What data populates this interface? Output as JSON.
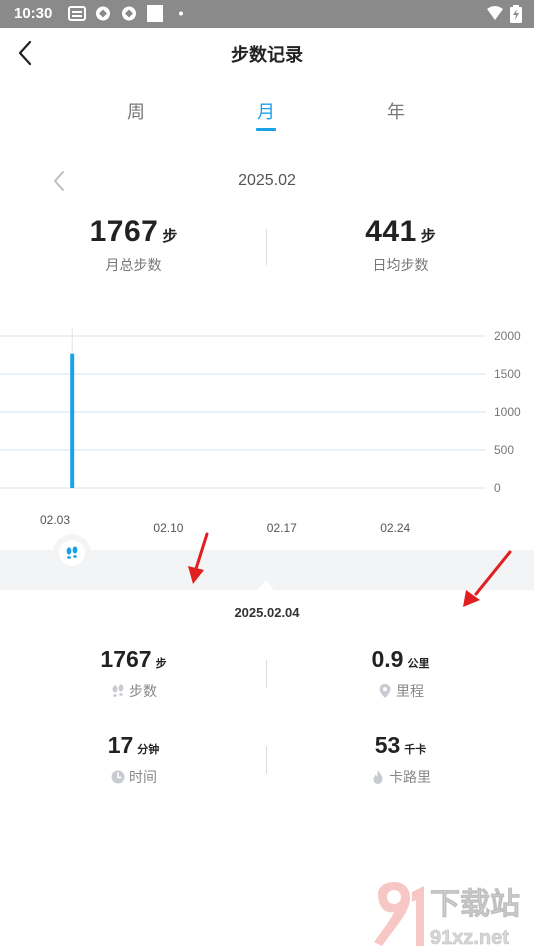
{
  "status": {
    "time": "10:30"
  },
  "header": {
    "title": "步数记录"
  },
  "tabs": [
    {
      "label": "周",
      "active": false
    },
    {
      "label": "月",
      "active": true
    },
    {
      "label": "年",
      "active": false
    }
  ],
  "date_nav": {
    "current": "2025.02"
  },
  "summary": {
    "total": {
      "value": "1767",
      "unit": "步",
      "label": "月总步数"
    },
    "average": {
      "value": "441",
      "unit": "步",
      "label": "日均步数"
    }
  },
  "chart_data": {
    "type": "bar",
    "x_tick_labels": [
      "02.03",
      "02.10",
      "02.17",
      "02.24"
    ],
    "y_tick_labels": [
      "2000",
      "1500",
      "1000",
      "500",
      "0"
    ],
    "ylim": [
      0,
      2000
    ],
    "bars": [
      {
        "x": "02.04",
        "value": 1767
      }
    ],
    "grid": true,
    "bar_color": "#1aa1ea"
  },
  "detail": {
    "date": "2025.02.04",
    "steps": {
      "value": "1767",
      "unit": "步",
      "label": "步数",
      "icon": "footprints-icon"
    },
    "distance": {
      "value": "0.9",
      "unit": "公里",
      "label": "里程",
      "icon": "location-pin-icon"
    },
    "time": {
      "value": "17",
      "unit": "分钟",
      "label": "时间",
      "icon": "clock-icon"
    },
    "calories": {
      "value": "53",
      "unit": "千卡",
      "label": "卡路里",
      "icon": "flame-icon"
    }
  },
  "watermark": {
    "text": "下载站",
    "domain": "91xz.net"
  },
  "colors": {
    "accent": "#1aa1ea",
    "arrow": "#e02020"
  }
}
